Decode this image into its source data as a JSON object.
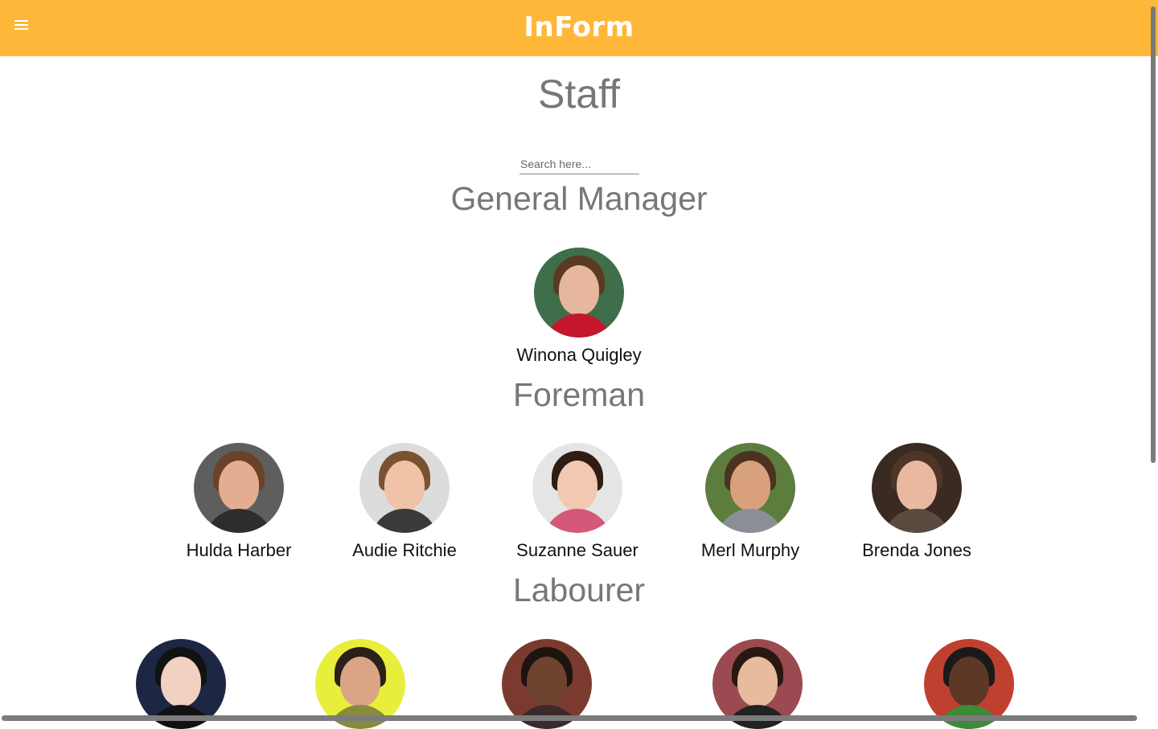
{
  "header": {
    "title": "InForm",
    "menu_icon": "hamburger-menu-icon",
    "background": "#FFB739"
  },
  "page": {
    "title": "Staff"
  },
  "search": {
    "placeholder": "Search here..."
  },
  "sections": [
    {
      "heading": "General Manager",
      "people": [
        {
          "name": "Winona Quigley",
          "bg": "#3f6e4a",
          "hair": "#5a3a22",
          "skin": "#e6b79c",
          "shirt": "#c4172b"
        }
      ]
    },
    {
      "heading": "Foreman",
      "people": [
        {
          "name": "Hulda Harber",
          "bg": "#5e5e5e",
          "hair": "#6b4128",
          "skin": "#e4ad92",
          "shirt": "#2d2d2d"
        },
        {
          "name": "Audie Ritchie",
          "bg": "#dcdcdc",
          "hair": "#7a5232",
          "skin": "#f0c2a6",
          "shirt": "#3a3a3a"
        },
        {
          "name": "Suzanne Sauer",
          "bg": "#e5e5e5",
          "hair": "#2f1d14",
          "skin": "#f1c9b3",
          "shirt": "#d4587a"
        },
        {
          "name": "Merl Murphy",
          "bg": "#5d7d3e",
          "hair": "#4b3320",
          "skin": "#d9a07e",
          "shirt": "#8a8f97"
        },
        {
          "name": "Brenda Jones",
          "bg": "#3b2a22",
          "hair": "#4e3526",
          "skin": "#e8b9a0",
          "shirt": "#5a4a40"
        }
      ]
    },
    {
      "heading": "Labourer",
      "people": [
        {
          "name": "",
          "bg": "#1d2744",
          "hair": "#121212",
          "skin": "#f1d2c2",
          "shirt": "#111111"
        },
        {
          "name": "",
          "bg": "#e8ee3c",
          "hair": "#2a2118",
          "skin": "#d9a585",
          "shirt": "#8a8a3c"
        },
        {
          "name": "",
          "bg": "#7b3a30",
          "hair": "#1d1410",
          "skin": "#6e4330",
          "shirt": "#3a2a2a"
        },
        {
          "name": "",
          "bg": "#9a4a50",
          "hair": "#2a1712",
          "skin": "#e7bb9e",
          "shirt": "#222222"
        },
        {
          "name": "",
          "bg": "#c04030",
          "hair": "#1a1a1a",
          "skin": "#5e3826",
          "shirt": "#3d8a3a"
        }
      ]
    }
  ]
}
